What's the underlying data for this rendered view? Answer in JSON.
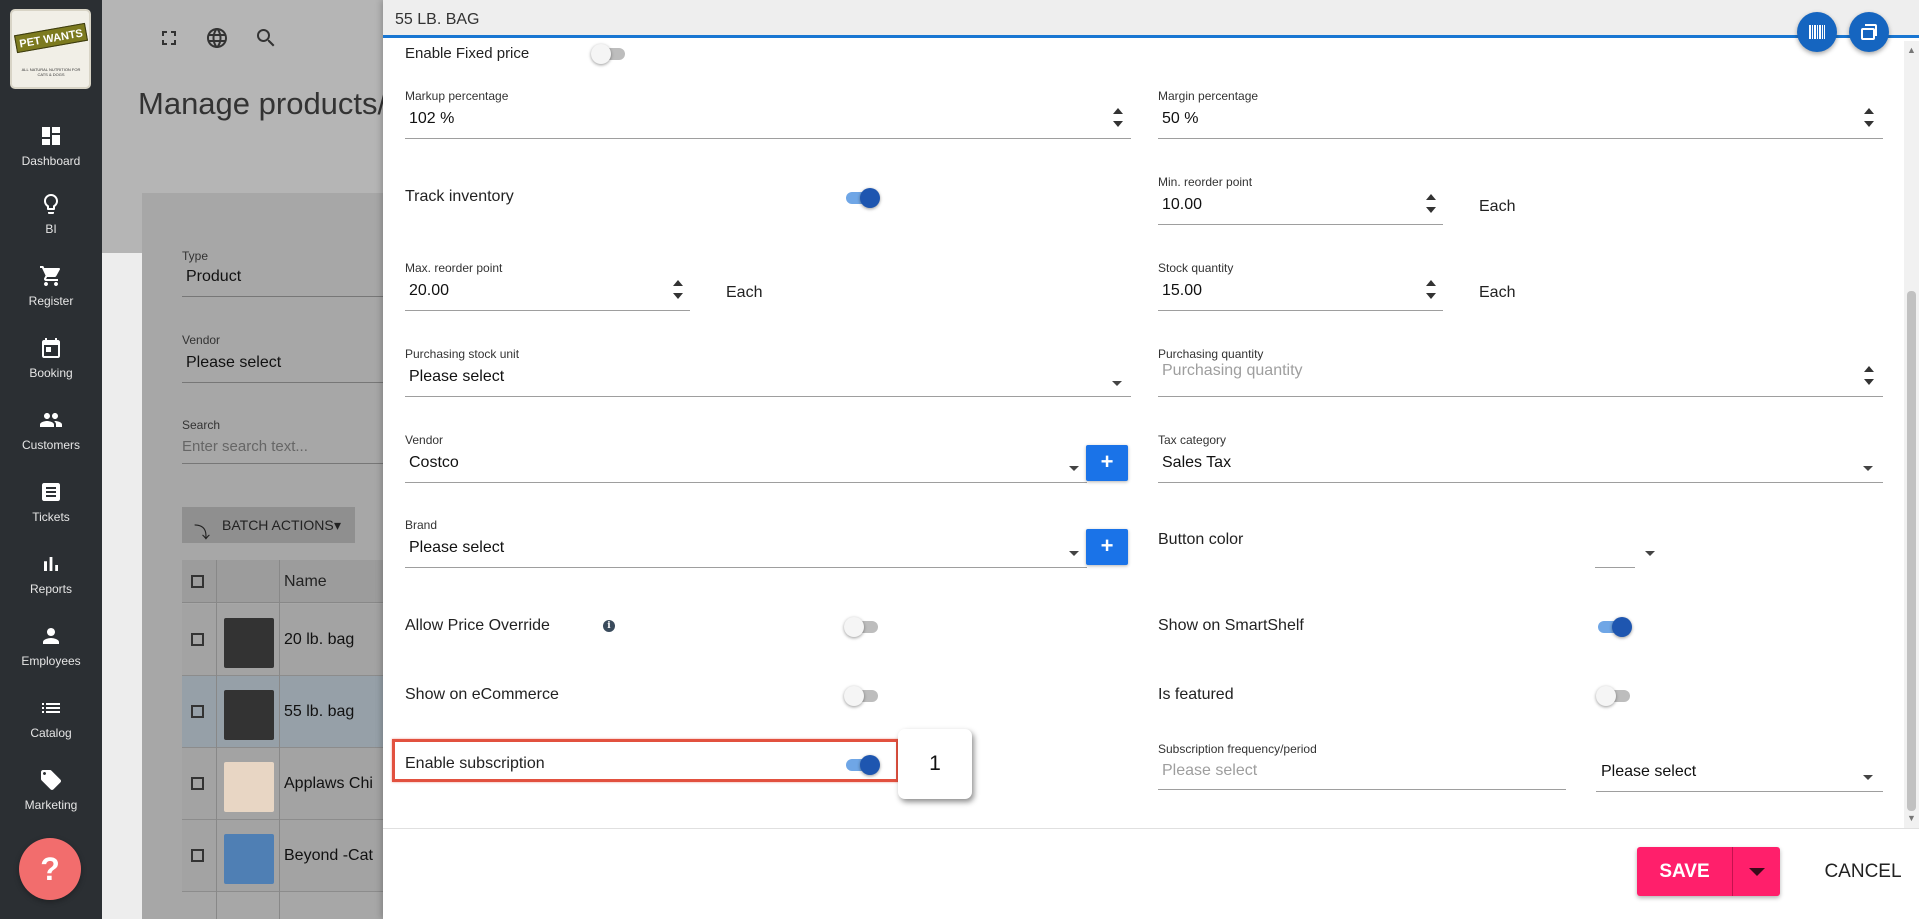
{
  "app": {
    "logo_text": "PET WANTS",
    "logo_tagline": "ALL NATURAL NUTRITION FOR CATS & DOGS"
  },
  "sidebar": {
    "items": [
      {
        "label": "Dashboard",
        "icon": "dashboard-icon"
      },
      {
        "label": "BI",
        "icon": "lightbulb-icon"
      },
      {
        "label": "Register",
        "icon": "cart-icon"
      },
      {
        "label": "Booking",
        "icon": "calendar-icon"
      },
      {
        "label": "Customers",
        "icon": "people-icon"
      },
      {
        "label": "Tickets",
        "icon": "ticket-icon"
      },
      {
        "label": "Reports",
        "icon": "bar-chart-icon"
      },
      {
        "label": "Employees",
        "icon": "person-icon"
      },
      {
        "label": "Catalog",
        "icon": "list-icon"
      },
      {
        "label": "Marketing",
        "icon": "tag-icon"
      }
    ],
    "help_label": "?"
  },
  "background_page": {
    "title": "Manage products/s",
    "type_label": "Type",
    "type_value": "Product",
    "vendor_label": "Vendor",
    "vendor_value": "Please select",
    "search_label": "Search",
    "search_placeholder": "Enter search text...",
    "batch_actions_label": "BATCH ACTIONS",
    "table_name_header": "Name",
    "rows": [
      {
        "name": "20 lb. bag",
        "selected": false
      },
      {
        "name": "55 lb. bag",
        "selected": true
      },
      {
        "name": "Applaws Chi",
        "selected": false
      },
      {
        "name": "Beyond -Cat",
        "selected": false
      }
    ]
  },
  "dialog": {
    "title": "55 LB. BAG",
    "enable_fixed_price_label": "Enable Fixed price",
    "enable_fixed_price_on": false,
    "markup_label": "Markup percentage",
    "markup_value": "102 %",
    "margin_label": "Margin percentage",
    "margin_value": "50 %",
    "track_inventory_label": "Track inventory",
    "track_inventory_on": true,
    "min_reorder_label": "Min. reorder point",
    "min_reorder_value": "10.00",
    "min_reorder_unit": "Each",
    "max_reorder_label": "Max. reorder point",
    "max_reorder_value": "20.00",
    "max_reorder_unit": "Each",
    "stock_qty_label": "Stock quantity",
    "stock_qty_value": "15.00",
    "stock_qty_unit": "Each",
    "purch_unit_label": "Purchasing stock unit",
    "purch_unit_value": "Please select",
    "purch_qty_label": "Purchasing quantity",
    "purch_qty_placeholder": "Purchasing quantity",
    "vendor_label": "Vendor",
    "vendor_value": "Costco",
    "tax_label": "Tax category",
    "tax_value": "Sales Tax",
    "brand_label": "Brand",
    "brand_value": "Please select",
    "button_color_label": "Button color",
    "plus_label": "+",
    "allow_override_label": "Allow Price Override",
    "allow_override_on": false,
    "info_glyph": "i",
    "smartshelf_label": "Show on SmartShelf",
    "smartshelf_on": true,
    "ecommerce_label": "Show on eCommerce",
    "ecommerce_on": false,
    "featured_label": "Is featured",
    "featured_on": false,
    "subscription_label": "Enable subscription",
    "subscription_on": true,
    "sub_freq_label": "Subscription frequency/period",
    "sub_freq_placeholder": "Please select",
    "sub_period_value": "Please select",
    "callout_number": "1",
    "save_label": "SAVE",
    "cancel_label": "CANCEL"
  },
  "colors": {
    "accent": "#1565c0",
    "save": "#ff1f6b",
    "highlight": "#e2513f",
    "sidebar": "#2b2f33"
  }
}
